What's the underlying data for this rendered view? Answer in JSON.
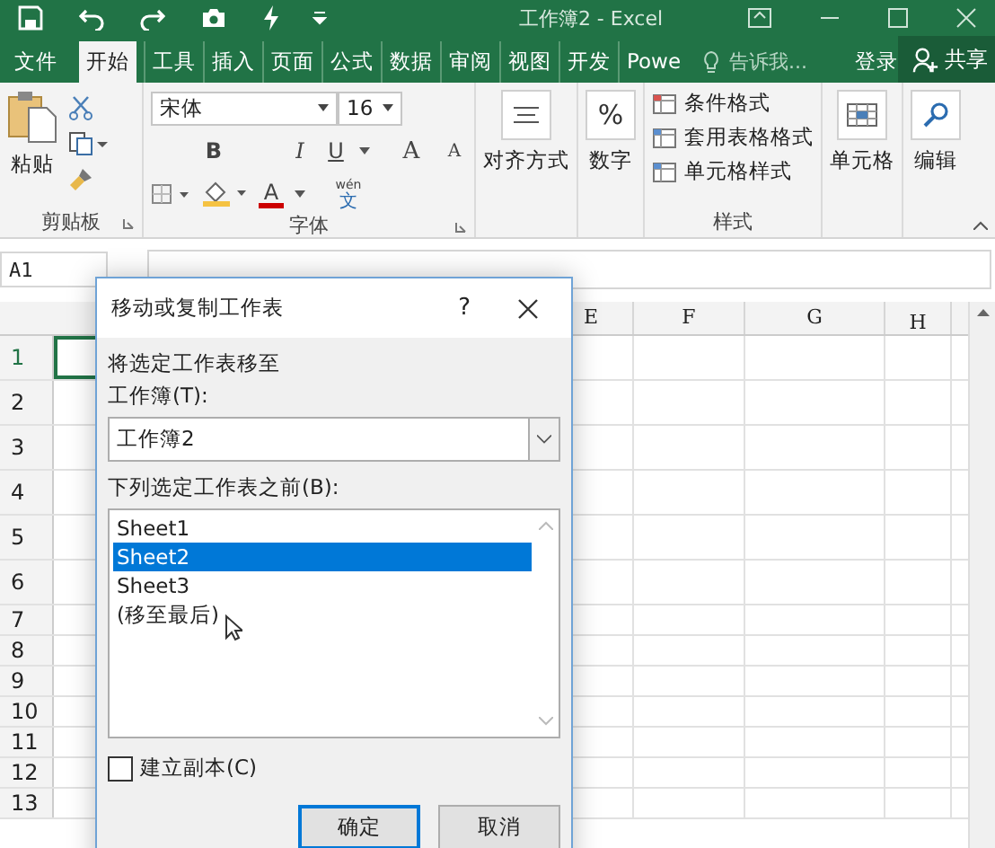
{
  "window": {
    "title": "工作簿2 - Excel"
  },
  "tabs": [
    {
      "label": "文件",
      "selected": false
    },
    {
      "label": "开始",
      "selected": true
    },
    {
      "label": "工具",
      "selected": false
    },
    {
      "label": "插入",
      "selected": false
    },
    {
      "label": "页面",
      "selected": false
    },
    {
      "label": "公式",
      "selected": false
    },
    {
      "label": "数据",
      "selected": false
    },
    {
      "label": "审阅",
      "selected": false
    },
    {
      "label": "视图",
      "selected": false
    },
    {
      "label": "开发",
      "selected": false
    },
    {
      "label": "Powe",
      "selected": false
    }
  ],
  "tell_me": {
    "placeholder": "告诉我..."
  },
  "sign_in": "登录",
  "share": "共享",
  "ribbon": {
    "clipboard": {
      "paste": "粘贴",
      "label": "剪贴板"
    },
    "font": {
      "name": "宋体",
      "size": "16",
      "bold": "B",
      "italic": "I",
      "underline": "U",
      "grow": "A",
      "shrink": "A",
      "font_color_letter": "A",
      "phonetic_top": "wén",
      "phonetic": "文",
      "label": "字体"
    },
    "alignment": {
      "label": "对齐方式"
    },
    "number": {
      "symbol": "%",
      "label": "数字"
    },
    "styles": {
      "items": [
        "条件格式",
        "套用表格格式",
        "单元格样式"
      ],
      "label": "样式"
    },
    "cells": {
      "label": "单元格"
    },
    "editing": {
      "label": "编辑"
    }
  },
  "name_box": "A1",
  "columns": [
    "E",
    "F",
    "G",
    "H"
  ],
  "rows": [
    "1",
    "2",
    "3",
    "4",
    "5",
    "6",
    "7",
    "8",
    "9",
    "10",
    "11",
    "12",
    "13"
  ],
  "dialog": {
    "title": "移动或复制工作表",
    "help": "?",
    "intro": "将选定工作表移至",
    "workbook_label": "工作簿(T):",
    "workbook": "工作簿2",
    "before_label": "下列选定工作表之前(B):",
    "sheets": [
      {
        "label": "Sheet1",
        "selected": false
      },
      {
        "label": "Sheet2",
        "selected": true
      },
      {
        "label": "Sheet3",
        "selected": false
      },
      {
        "label": "(移至最后)",
        "selected": false
      }
    ],
    "copy": {
      "label": "建立副本(C)",
      "checked": false
    },
    "buttons": [
      "确定",
      "取消"
    ]
  }
}
